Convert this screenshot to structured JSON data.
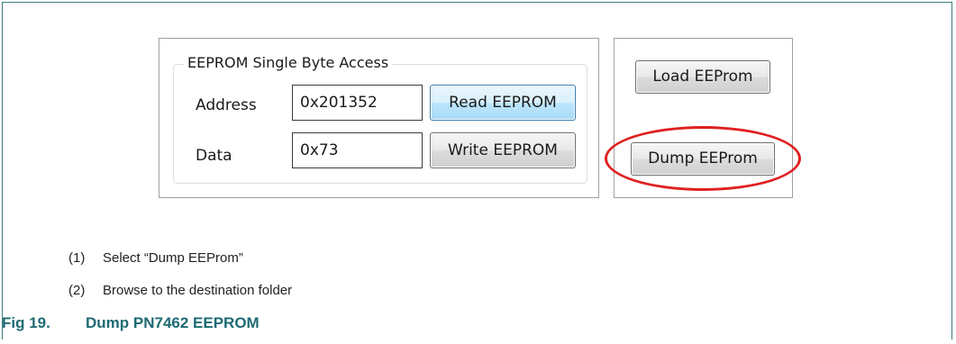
{
  "eeprom_panel": {
    "group_title": "EEPROM Single Byte Access",
    "address_label": "Address",
    "address_value": "0x201352",
    "read_button": "Read EEPROM",
    "data_label": "Data",
    "data_value": "0x73",
    "write_button": "Write EEPROM"
  },
  "side_panel": {
    "load_button": "Load EEProm",
    "dump_button": "Dump EEProm",
    "highlight_color": "#e02020"
  },
  "steps": [
    {
      "number": "(1)",
      "text": "Select “Dump EEProm”"
    },
    {
      "number": "(2)",
      "text": "Browse to the destination folder"
    }
  ],
  "caption": {
    "label": "Fig 19.",
    "text": "Dump PN7462 EEPROM",
    "color": "#1e6b73"
  }
}
